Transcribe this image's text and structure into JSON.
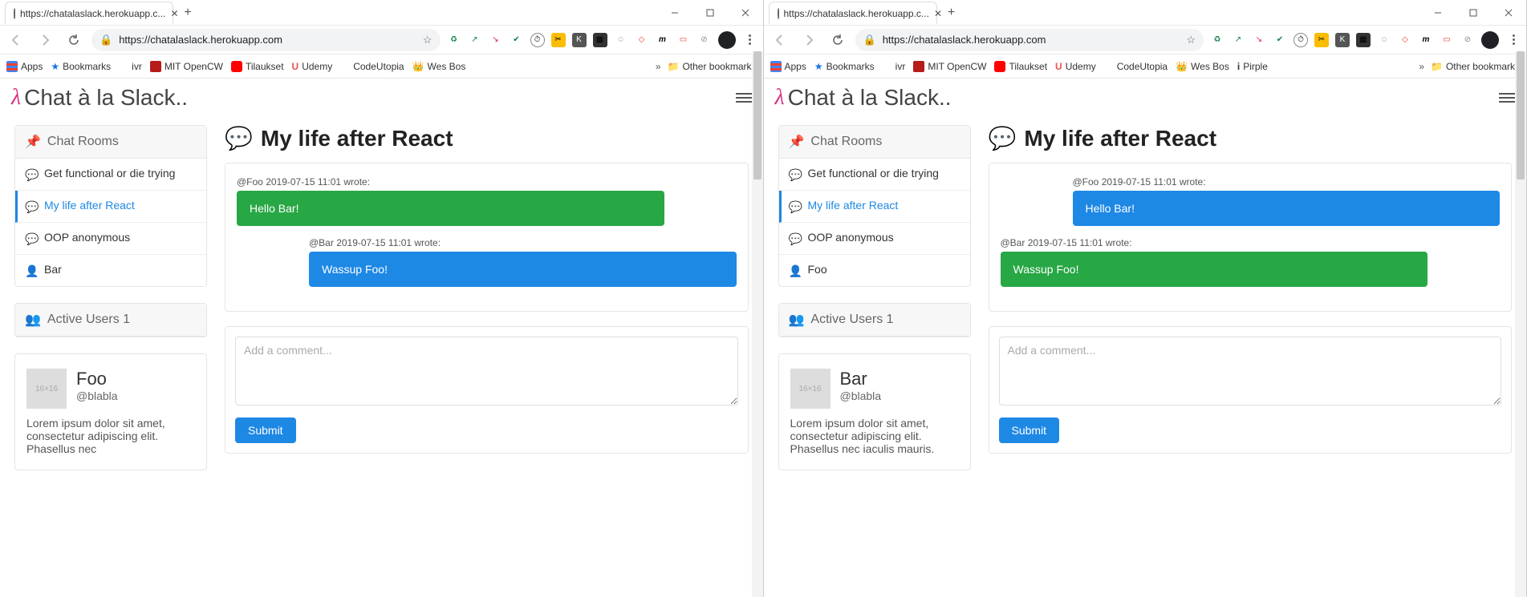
{
  "windows": [
    {
      "tab_title": "https://chatalaslack.herokuapp.c...",
      "url": "https://chatalaslack.herokuapp.com",
      "bookmarks": [
        {
          "label": "Apps",
          "color": "#888"
        },
        {
          "label": "Bookmarks",
          "color": "#1a73e8"
        },
        {
          "label": "ivr",
          "color": "#888"
        },
        {
          "label": "MIT OpenCW",
          "color": "#b71c1c"
        },
        {
          "label": "Tilaukset",
          "color": "#ff0000"
        },
        {
          "label": "Udemy",
          "color": "#ec5252"
        },
        {
          "label": "CodeUtopia",
          "color": "#888"
        },
        {
          "label": "Wes Bos",
          "color": "#f0a500"
        }
      ],
      "other_bookmarks": "Other bookmarks",
      "avatar_color": "#202124",
      "app_title": "Chat à la Slack..",
      "rooms_header": "Chat Rooms",
      "rooms": [
        {
          "label": "Get functional or die trying",
          "icon": "chat",
          "active": false
        },
        {
          "label": "My life after React",
          "icon": "chat",
          "active": true
        },
        {
          "label": "OOP anonymous",
          "icon": "chat",
          "active": false
        },
        {
          "label": "Bar",
          "icon": "user",
          "active": false
        }
      ],
      "active_users_header": "Active Users 1",
      "user": {
        "name": "Foo",
        "handle": "@blabla",
        "bio": "Lorem ipsum dolor sit amet, consectetur adipiscing elit. Phasellus nec"
      },
      "room_title": "My life after React",
      "messages": [
        {
          "meta": "@Foo 2019-07-15 11:01 wrote:",
          "text": "Hello Bar!",
          "side": "left",
          "color": "green"
        },
        {
          "meta": "@Bar 2019-07-15 11:01 wrote:",
          "text": "Wassup Foo!",
          "side": "right",
          "color": "blue"
        }
      ],
      "comment_placeholder": "Add a comment...",
      "submit_label": "Submit"
    },
    {
      "tab_title": "https://chatalaslack.herokuapp.c...",
      "url": "https://chatalaslack.herokuapp.com",
      "bookmarks": [
        {
          "label": "Apps",
          "color": "#888"
        },
        {
          "label": "Bookmarks",
          "color": "#1a73e8"
        },
        {
          "label": "ivr",
          "color": "#888"
        },
        {
          "label": "MIT OpenCW",
          "color": "#b71c1c"
        },
        {
          "label": "Tilaukset",
          "color": "#ff0000"
        },
        {
          "label": "Udemy",
          "color": "#ec5252"
        },
        {
          "label": "CodeUtopia",
          "color": "#888"
        },
        {
          "label": "Wes Bos",
          "color": "#f0a500"
        },
        {
          "label": "Pirple",
          "color": "#333"
        }
      ],
      "other_bookmarks": "Other bookmarks",
      "avatar_color": "#202124",
      "app_title": "Chat à la Slack..",
      "rooms_header": "Chat Rooms",
      "rooms": [
        {
          "label": "Get functional or die trying",
          "icon": "chat",
          "active": false
        },
        {
          "label": "My life after React",
          "icon": "chat",
          "active": true
        },
        {
          "label": "OOP anonymous",
          "icon": "chat",
          "active": false
        },
        {
          "label": "Foo",
          "icon": "user",
          "active": false
        }
      ],
      "active_users_header": "Active Users 1",
      "user": {
        "name": "Bar",
        "handle": "@blabla",
        "bio": "Lorem ipsum dolor sit amet, consectetur adipiscing elit. Phasellus nec iaculis mauris."
      },
      "room_title": "My life after React",
      "messages": [
        {
          "meta": "@Foo 2019-07-15 11:01 wrote:",
          "text": "Hello Bar!",
          "side": "right",
          "color": "blue"
        },
        {
          "meta": "@Bar 2019-07-15 11:01 wrote:",
          "text": "Wassup Foo!",
          "side": "left",
          "color": "green"
        }
      ],
      "comment_placeholder": "Add a comment...",
      "submit_label": "Submit"
    }
  ]
}
